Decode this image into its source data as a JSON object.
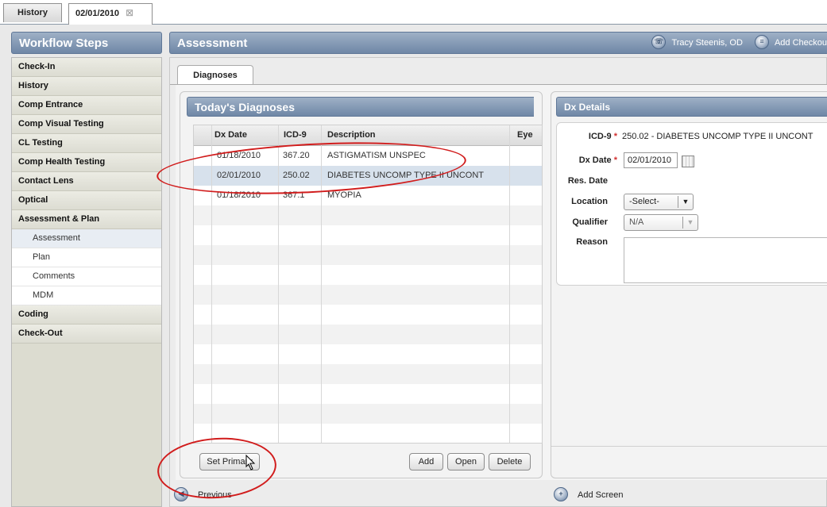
{
  "top_tabs": {
    "history": "History",
    "date": "02/01/2010",
    "close_glyph": "⊠"
  },
  "sidebar": {
    "title": "Workflow Steps",
    "items": [
      {
        "label": "Check-In",
        "type": "step"
      },
      {
        "label": "History",
        "type": "step"
      },
      {
        "label": "Comp Entrance",
        "type": "step"
      },
      {
        "label": "Comp Visual Testing",
        "type": "step"
      },
      {
        "label": "CL Testing",
        "type": "step"
      },
      {
        "label": "Comp Health Testing",
        "type": "step"
      },
      {
        "label": "Contact Lens",
        "type": "step"
      },
      {
        "label": "Optical",
        "type": "step"
      },
      {
        "label": "Assessment & Plan",
        "type": "step"
      },
      {
        "label": "Assessment",
        "type": "sub",
        "selected": true
      },
      {
        "label": "Plan",
        "type": "sub"
      },
      {
        "label": "Comments",
        "type": "sub"
      },
      {
        "label": "MDM",
        "type": "sub"
      },
      {
        "label": "Coding",
        "type": "step"
      },
      {
        "label": "Check-Out",
        "type": "step"
      }
    ]
  },
  "assessment": {
    "title": "Assessment",
    "user": "Tracy Steenis, OD",
    "add_checkout": "Add Checkou",
    "user_icon": "person-phone-icon",
    "checkout_icon": "checklist-icon"
  },
  "tabs": {
    "diagnoses": "Diagnoses"
  },
  "todays_diagnoses": {
    "title": "Today's Diagnoses",
    "columns": [
      "Dx Date",
      "ICD-9",
      "Description",
      "Eye"
    ],
    "rows": [
      {
        "date": "01/18/2010",
        "icd": "367.20",
        "desc": "ASTIGMATISM UNSPEC",
        "eye": ""
      },
      {
        "date": "02/01/2010",
        "icd": "250.02",
        "desc": "DIABETES UNCOMP TYPE II UNCONT",
        "eye": "",
        "selected": true
      },
      {
        "date": "01/18/2010",
        "icd": "367.1",
        "desc": "MYOPIA",
        "eye": ""
      }
    ],
    "buttons": {
      "set_primary": "Set Primary",
      "add": "Add",
      "open": "Open",
      "delete": "Delete"
    }
  },
  "dx_details": {
    "title": "Dx Details",
    "icd_label": "ICD-9",
    "icd_value": "250.02 - DIABETES UNCOMP TYPE II UNCONT",
    "dx_date_label": "Dx Date",
    "dx_date_value": "02/01/2010",
    "res_date_label": "Res. Date",
    "location_label": "Location",
    "location_value": "-Select-",
    "qualifier_label": "Qualifier",
    "qualifier_value": "N/A",
    "reason_label": "Reason",
    "required_glyph": "*"
  },
  "footer": {
    "previous": "Previous",
    "add_screen": "Add Screen"
  },
  "colors": {
    "header_blue": "#7a90ad",
    "annotation_red": "#d11c1c",
    "selected_row": "#d7e1ec"
  }
}
